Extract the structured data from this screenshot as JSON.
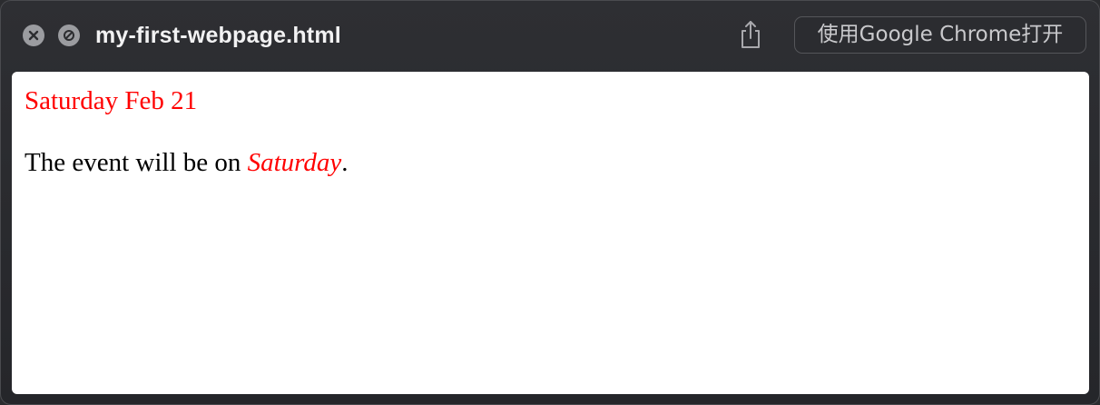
{
  "window": {
    "title": "my-first-webpage.html",
    "open_with_button_label": "使用Google Chrome打开",
    "icons": {
      "close": "close-icon",
      "block": "block-icon",
      "share": "share-icon"
    }
  },
  "page": {
    "heading": "Saturday Feb 21",
    "paragraph_prefix": "The event will be on ",
    "paragraph_emphasis": "Saturday",
    "paragraph_suffix": "."
  },
  "colors": {
    "accent_red": "#ff0000",
    "titlebar": "#2e2f33",
    "page_background": "#ffffff"
  }
}
